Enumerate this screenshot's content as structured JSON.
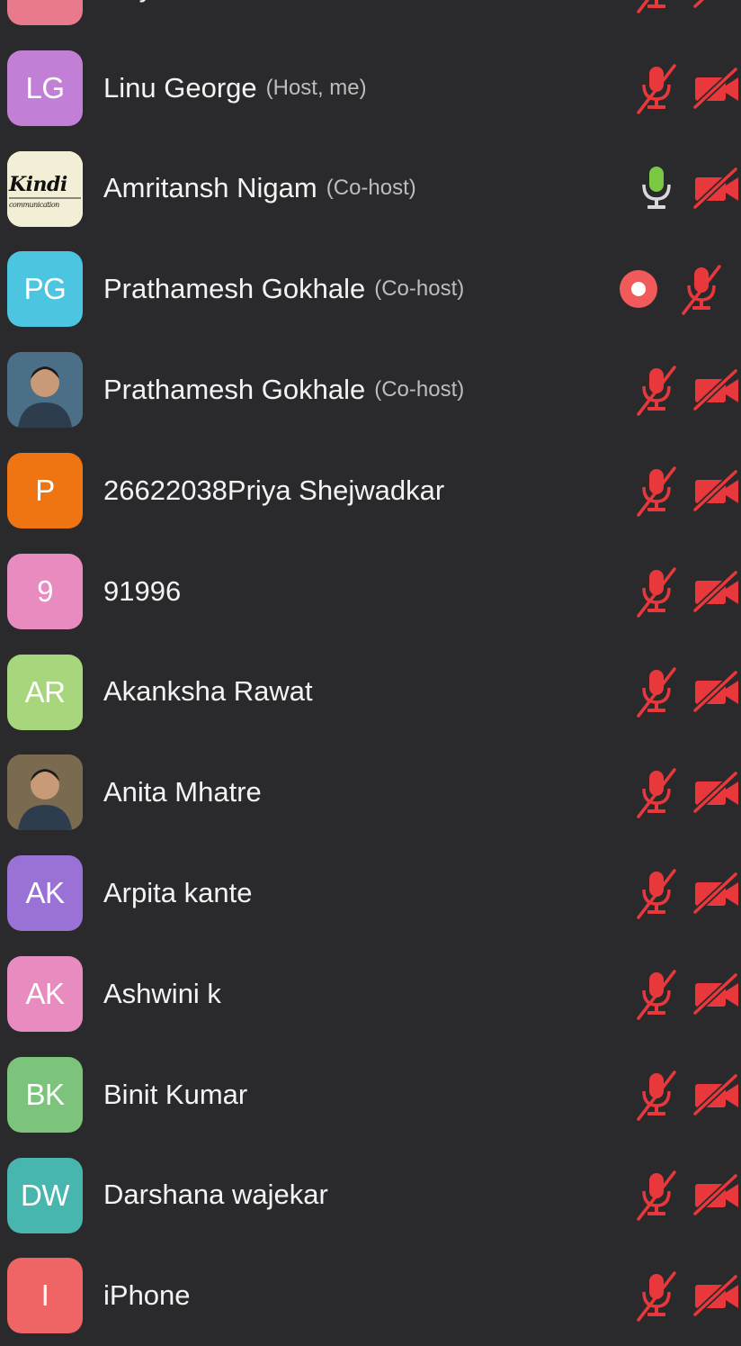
{
  "participants": [
    {
      "name": "Haylie Ahmed",
      "role": "",
      "initials": "",
      "avatar_type": "initials",
      "avatar_color": "#e87a8c",
      "mic": "off",
      "video": "off",
      "recording": false
    },
    {
      "name": "Linu George",
      "role": "(Host, me)",
      "initials": "LG",
      "avatar_type": "initials",
      "avatar_color": "#c27fd6",
      "mic": "off",
      "video": "off",
      "recording": false
    },
    {
      "name": "Amritansh Nigam",
      "role": "(Co-host)",
      "initials": "",
      "avatar_type": "logo",
      "avatar_color": "#f3efd6",
      "mic": "on",
      "video": "off",
      "recording": false
    },
    {
      "name": "Prathamesh Gokhale",
      "role": "(Co-host)",
      "initials": "PG",
      "avatar_type": "initials",
      "avatar_color": "#4cc6e0",
      "mic": "off",
      "video": "none",
      "recording": true
    },
    {
      "name": "Prathamesh Gokhale",
      "role": "(Co-host)",
      "initials": "",
      "avatar_type": "photo",
      "avatar_color": "#4a6f86",
      "mic": "off",
      "video": "off",
      "recording": false
    },
    {
      "name": "26622038Priya Shejwadkar",
      "role": "",
      "initials": "P",
      "avatar_type": "initials",
      "avatar_color": "#ef7412",
      "mic": "off",
      "video": "off",
      "recording": false
    },
    {
      "name": "91996",
      "role": "",
      "initials": "9",
      "avatar_type": "initials",
      "avatar_color": "#e88cc0",
      "mic": "off",
      "video": "off",
      "recording": false
    },
    {
      "name": "Akanksha Rawat",
      "role": "",
      "initials": "AR",
      "avatar_type": "initials",
      "avatar_color": "#a8d67c",
      "mic": "off",
      "video": "off",
      "recording": false
    },
    {
      "name": "Anita Mhatre",
      "role": "",
      "initials": "",
      "avatar_type": "photo",
      "avatar_color": "#7a6a50",
      "mic": "off",
      "video": "off",
      "recording": false
    },
    {
      "name": "Arpita kante",
      "role": "",
      "initials": "AK",
      "avatar_type": "initials",
      "avatar_color": "#9a72d6",
      "mic": "off",
      "video": "off",
      "recording": false
    },
    {
      "name": "Ashwini k",
      "role": "",
      "initials": "AK",
      "avatar_type": "initials",
      "avatar_color": "#e88cc0",
      "mic": "off",
      "video": "off",
      "recording": false
    },
    {
      "name": "Binit Kumar",
      "role": "",
      "initials": "BK",
      "avatar_type": "initials",
      "avatar_color": "#7cc47c",
      "mic": "off",
      "video": "off",
      "recording": false
    },
    {
      "name": "Darshana wajekar",
      "role": "",
      "initials": "DW",
      "avatar_type": "initials",
      "avatar_color": "#47b6ae",
      "mic": "off",
      "video": "off",
      "recording": false
    },
    {
      "name": "iPhone",
      "role": "",
      "initials": "I",
      "avatar_type": "initials",
      "avatar_color": "#ef6464",
      "mic": "off",
      "video": "off",
      "recording": false
    }
  ],
  "logo_text": {
    "line1": "Kindi",
    "line2": "communication"
  },
  "colors": {
    "background": "#2a2a2c",
    "muted_red": "#e8383c",
    "mic_on_green": "#7ac943",
    "recording_red": "#f05a5a"
  }
}
